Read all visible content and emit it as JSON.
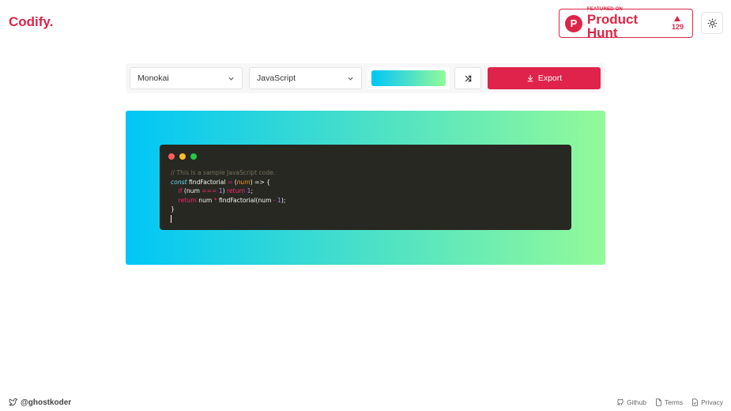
{
  "header": {
    "logo": "Codify.",
    "product_hunt": {
      "featured": "FEATURED ON",
      "name": "Product Hunt",
      "votes": "129",
      "letter": "P"
    },
    "theme_toggle_icon": "sun-icon"
  },
  "toolbar": {
    "theme_select": {
      "value": "Monokai"
    },
    "language_select": {
      "value": "JavaScript"
    },
    "background_gradient": {
      "from": "#00c6f7",
      "to": "#93fa9a"
    },
    "random_icon": "shuffle-icon",
    "export_label": "Export"
  },
  "editor": {
    "window_dots": [
      "#ff5f56",
      "#ffbd2e",
      "#27c93f"
    ],
    "lines": {
      "l1": "// This is a sample JavaScript code.",
      "l2_kw": "const",
      "l2_name": " findFactorial ",
      "l2_eq": "=",
      "l2_open": " (",
      "l2_param": "num",
      "l2_close": ") => {",
      "l3_if": "if",
      "l3_a": " (num ",
      "l3_op": "===",
      "l3_num": " 1",
      "l3_b": ") ",
      "l3_ret": "return",
      "l3_num2": " 1",
      "l3_end": ";",
      "l4_ret": "return",
      "l4_a": " num ",
      "l4_op": "*",
      "l4_b": " findFactorial(num ",
      "l4_op2": "-",
      "l4_num": " 1",
      "l4_end": ");",
      "l5": "}"
    }
  },
  "footer": {
    "twitter_handle": "@ghostkoder",
    "links": {
      "github": "Github",
      "terms": "Terms",
      "privacy": "Privacy"
    }
  },
  "colors": {
    "accent": "#dc2648",
    "editor_bg": "#272822"
  }
}
